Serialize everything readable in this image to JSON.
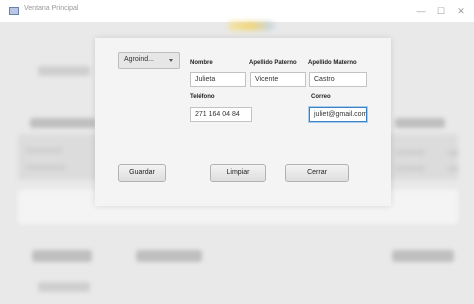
{
  "window": {
    "title": "Ventana Principal",
    "minimize_glyph": "—",
    "maximize_glyph": "☐",
    "close_glyph": "✕"
  },
  "dialog": {
    "combo": {
      "selected": "Agroind..."
    },
    "labels": {
      "nombre": "Nombre",
      "apellido_paterno": "Apellido Paterno",
      "apellido_materno": "Apellido Materno",
      "telefono": "Teléfono",
      "correo": "Correo"
    },
    "fields": {
      "nombre": "Julieta",
      "apellido_paterno": "Vicente",
      "apellido_materno": "Castro",
      "telefono": "271 164 04 84",
      "correo": "juliet@gmail.com"
    },
    "buttons": {
      "guardar": "Guardar",
      "limpiar": "Limpiar",
      "cerrar": "Cerrar"
    }
  },
  "colors": {
    "accent": "#f2d36b",
    "focus": "#3b82c4"
  }
}
